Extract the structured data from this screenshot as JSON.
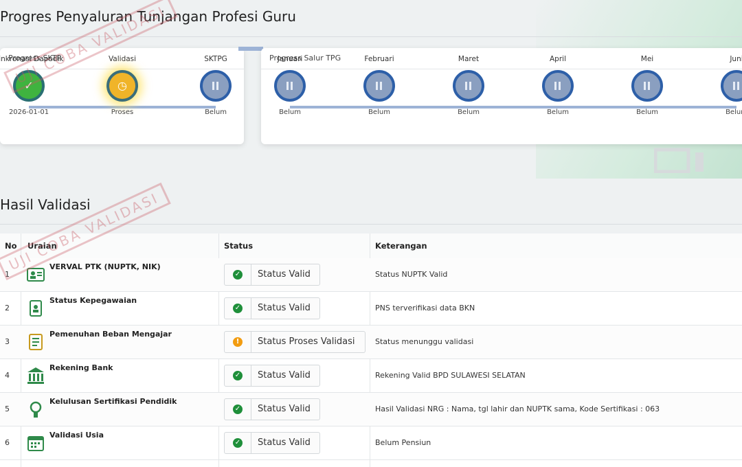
{
  "page": {
    "title": "Progres Penyaluran Tunjangan Profesi Guru"
  },
  "sxtp": {
    "title": "Progress SKTP",
    "steps": [
      {
        "label": "Sinkronasi Dapodik",
        "sub": "2026-01-01",
        "state": "done",
        "icon": "check-icon"
      },
      {
        "label": "Validasi",
        "sub": "Proses",
        "state": "process",
        "icon": "clock-icon"
      },
      {
        "label": "SKTPG",
        "sub": "Belum",
        "state": "pending",
        "icon": "pause-icon"
      }
    ]
  },
  "tpg": {
    "title": "Progress Salur TPG",
    "steps": [
      {
        "label": "Januari",
        "sub": "Belum",
        "state": "pending",
        "icon": "pause-icon"
      },
      {
        "label": "Februari",
        "sub": "Belum",
        "state": "pending",
        "icon": "pause-icon"
      },
      {
        "label": "Maret",
        "sub": "Belum",
        "state": "pending",
        "icon": "pause-icon"
      },
      {
        "label": "April",
        "sub": "Belum",
        "state": "pending",
        "icon": "pause-icon"
      },
      {
        "label": "Mei",
        "sub": "Belum",
        "state": "pending",
        "icon": "pause-icon"
      },
      {
        "label": "Juni",
        "sub": "Belum",
        "state": "pending",
        "icon": "pause-icon"
      }
    ]
  },
  "validasi": {
    "title": "Hasil Validasi",
    "columns": [
      "No",
      "Uraian",
      "Status",
      "Keterangan"
    ],
    "rows": [
      {
        "no": "1",
        "uraian": "VERVAL PTK (NUPTK, NIK)",
        "icon": "id-card-icon",
        "status": "Status Valid",
        "status_type": "valid",
        "keterangan": "Status NUPTK Valid"
      },
      {
        "no": "2",
        "uraian": "Status Kepegawaian",
        "icon": "employee-badge-icon",
        "status": "Status Valid",
        "status_type": "valid",
        "keterangan": "PNS terverifikasi data BKN"
      },
      {
        "no": "3",
        "uraian": "Pemenuhan Beban Mengajar",
        "icon": "notebook-icon",
        "status": "Status Proses Validasi",
        "status_type": "process",
        "keterangan": "Status menunggu validasi"
      },
      {
        "no": "4",
        "uraian": "Rekening Bank",
        "icon": "bank-icon",
        "status": "Status Valid",
        "status_type": "valid",
        "keterangan": "Rekening Valid BPD SULAWESI SELATAN"
      },
      {
        "no": "5",
        "uraian": "Kelulusan Sertifikasi Pendidik",
        "icon": "award-icon",
        "status": "Status Valid",
        "status_type": "valid",
        "keterangan": "Hasil Validasi NRG : Nama, tgl lahir dan NUPTK sama, Kode Sertifikasi : 063"
      },
      {
        "no": "6",
        "uraian": "Validasi Usia",
        "icon": "calendar-icon",
        "status": "Status Valid",
        "status_type": "valid",
        "keterangan": "Belum Pensiun"
      }
    ]
  },
  "watermark": "UJI COBA VALIDASI",
  "colors": {
    "done": "#3fb33f",
    "process": "#f0b429",
    "pending": "#8a9fc0",
    "valid": "#1f8f3a",
    "warning": "#f29c11",
    "track": "#9db3d6"
  }
}
